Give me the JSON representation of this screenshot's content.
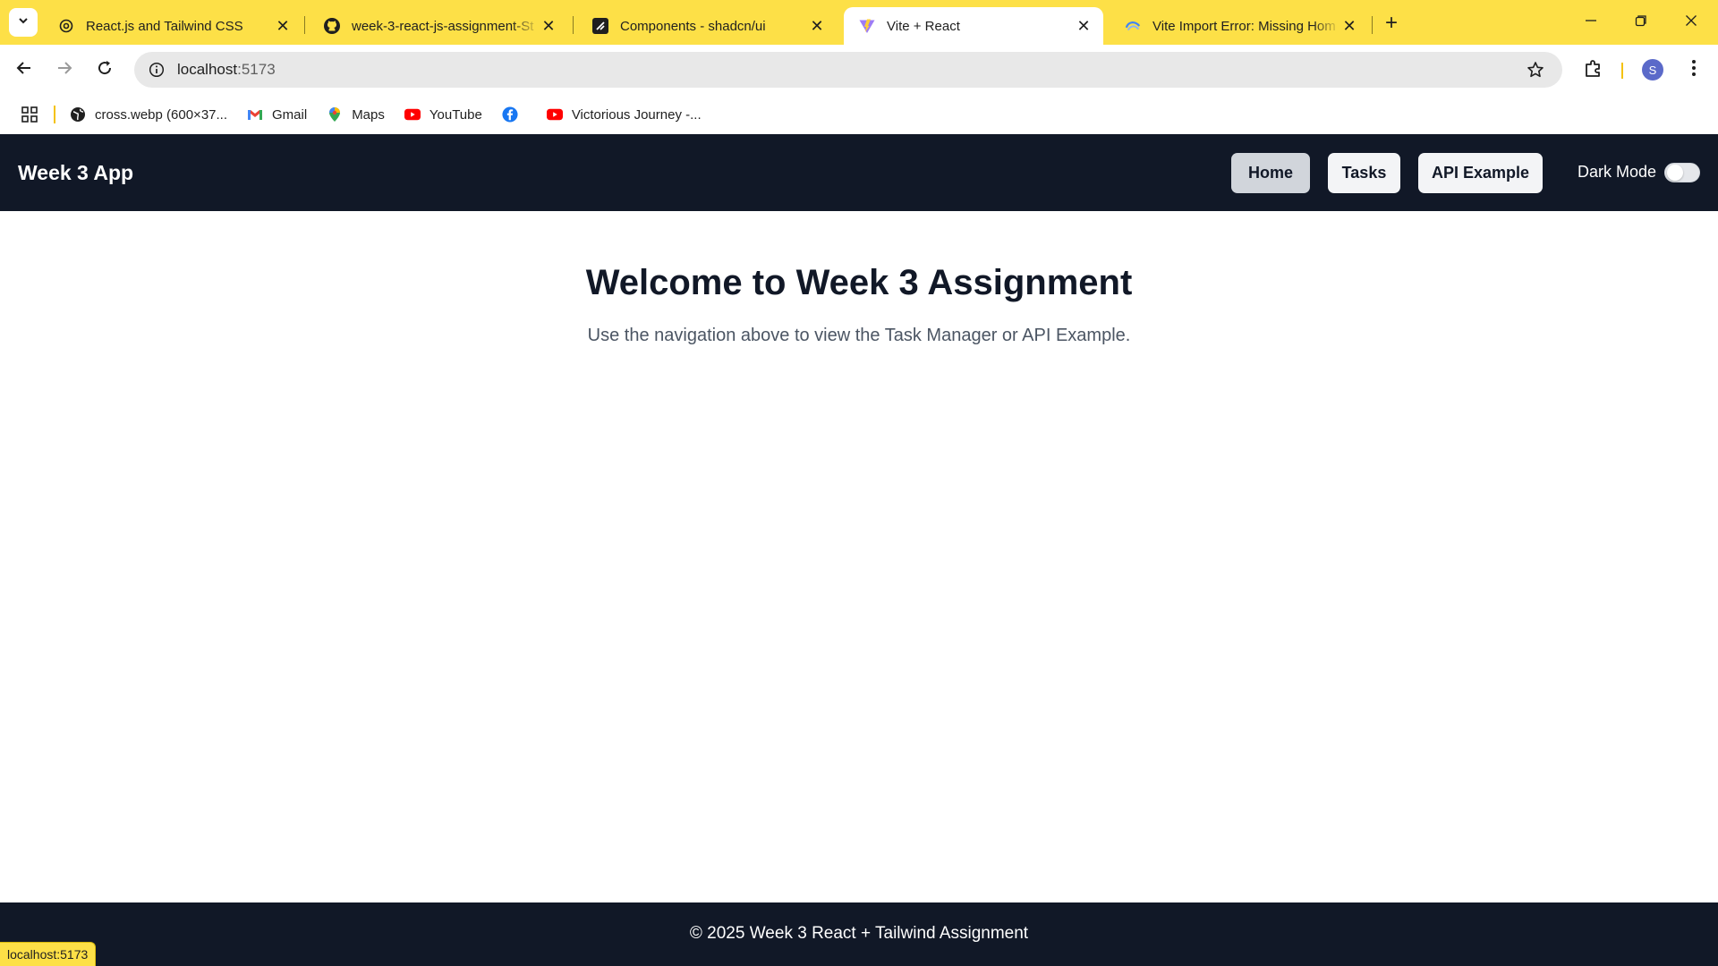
{
  "browser": {
    "theme_color": "#fde047",
    "tabs": [
      {
        "title": "React.js and Tailwind CSS",
        "favicon": "openai-icon",
        "active": false
      },
      {
        "title": "week-3-react-js-assignment-St",
        "favicon": "github-icon",
        "active": false
      },
      {
        "title": "Components - shadcn/ui",
        "favicon": "shadcn-icon",
        "active": false
      },
      {
        "title": "Vite + React",
        "favicon": "vite-icon",
        "active": true
      },
      {
        "title": "Vite Import Error: Missing Hom",
        "favicon": "gemini-icon",
        "active": false
      }
    ],
    "address": {
      "host": "localhost",
      "port": ":5173"
    },
    "profile_initial": "S",
    "bookmarks": [
      {
        "label": "cross.webp (600×37...",
        "icon": "globe-icon"
      },
      {
        "label": "Gmail",
        "icon": "gmail-icon"
      },
      {
        "label": "Maps",
        "icon": "maps-pin-icon"
      },
      {
        "label": "YouTube",
        "icon": "youtube-icon"
      },
      {
        "label": "",
        "icon": "facebook-icon"
      },
      {
        "label": "Victorious Journey -...",
        "icon": "youtube-icon"
      }
    ],
    "status_text": "localhost:5173"
  },
  "app": {
    "brand": "Week 3 App",
    "nav": [
      {
        "label": "Home",
        "active": true
      },
      {
        "label": "Tasks",
        "active": false
      },
      {
        "label": "API Example",
        "active": false
      }
    ],
    "dark_mode_label": "Dark Mode",
    "dark_mode_on": false,
    "nav_bg": "#111827",
    "hero": {
      "title": "Welcome to Week 3 Assignment",
      "subtitle": "Use the navigation above to view the Task Manager or API Example."
    },
    "footer": "© 2025 Week 3 React + Tailwind Assignment"
  }
}
